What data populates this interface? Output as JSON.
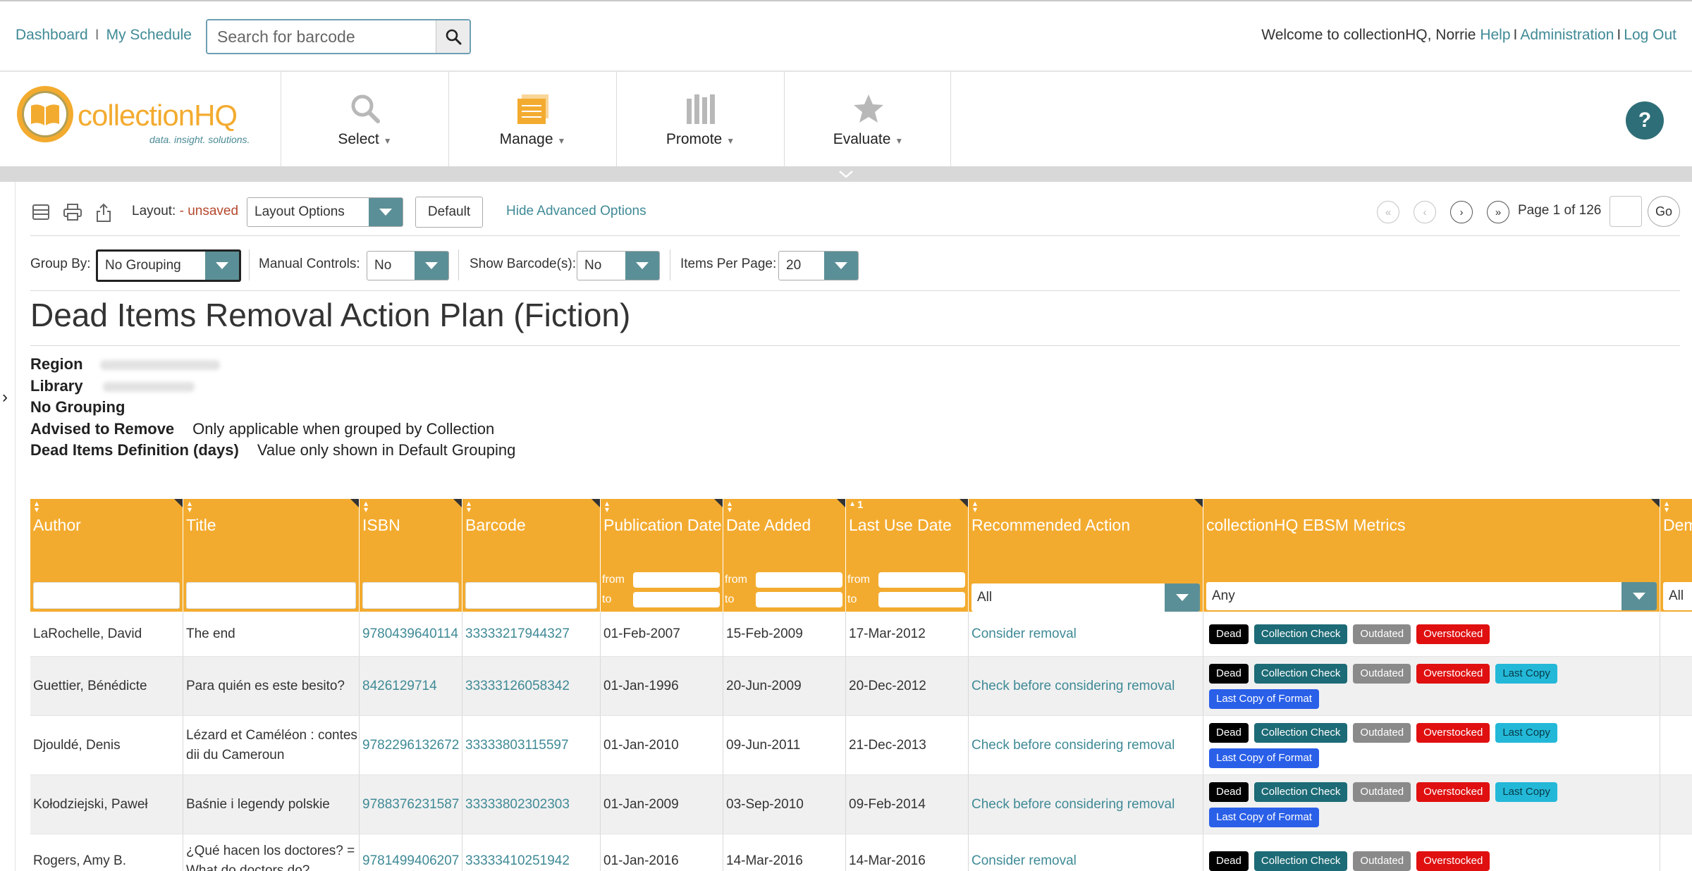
{
  "topbar": {
    "links": [
      "Dashboard",
      "My Schedule"
    ],
    "search_placeholder": "Search for barcode",
    "welcome": "Welcome to collectionHQ, Norrie",
    "user_links": [
      "Help",
      "Administration",
      "Log Out"
    ]
  },
  "logo": {
    "name": "collectionHQ",
    "tagline": "data. insight. solutions."
  },
  "nav": [
    {
      "label": "Select",
      "icon": "search-icon"
    },
    {
      "label": "Manage",
      "icon": "layers-icon"
    },
    {
      "label": "Promote",
      "icon": "books-icon"
    },
    {
      "label": "Evaluate",
      "icon": "star-icon"
    }
  ],
  "help_button": "?",
  "toolbar": {
    "layout_label": "Layout:",
    "layout_status": "- unsaved",
    "layout_options": "Layout Options",
    "default_label": "Default",
    "hide_advanced": "Hide Advanced Options",
    "page_info": "Page 1 of 126",
    "go_label": "Go"
  },
  "options": {
    "group_by_label": "Group By:",
    "group_by_value": "No Grouping",
    "manual_controls_label": "Manual Controls:",
    "manual_controls_value": "No",
    "show_barcodes_label": "Show Barcode(s):",
    "show_barcodes_value": "No",
    "items_per_page_label": "Items Per Page:",
    "items_per_page_value": "20"
  },
  "report": {
    "title": "Dead Items Removal Action Plan (Fiction)",
    "region_label": "Region",
    "library_label": "Library",
    "grouping_label": "No Grouping",
    "advised_label": "Advised to Remove",
    "advised_value": "Only applicable when grouped by Collection",
    "definition_label": "Dead Items Definition (days)",
    "definition_value": "Value only shown in Default Grouping"
  },
  "grid": {
    "columns": [
      "Author",
      "Title",
      "ISBN",
      "Barcode",
      "Publication Date",
      "Date Added",
      "Last Use Date",
      "Recommended Action",
      "collectionHQ EBSM Metrics",
      "Dem"
    ],
    "range_from": "from",
    "range_to": "to",
    "sort_index": "1",
    "action_filter": "All",
    "metrics_filter": "Any",
    "dem_filter": "All",
    "rows": [
      {
        "author": "LaRochelle, David",
        "title": "The end",
        "isbn": "9780439640114",
        "barcode": "33333217944327",
        "pub": "01-Feb-2007",
        "added": "15-Feb-2009",
        "last_use": "17-Mar-2012",
        "action": "Consider removal",
        "badges": [
          "Dead",
          "Collection Check",
          "Outdated",
          "Overstocked"
        ]
      },
      {
        "author": "Guettier, Bénédicte",
        "title": "Para quién es este besito?",
        "isbn": "8426129714",
        "barcode": "33333126058342",
        "pub": "01-Jan-1996",
        "added": "20-Jun-2009",
        "last_use": "20-Dec-2012",
        "action": "Check before considering removal",
        "badges": [
          "Dead",
          "Collection Check",
          "Outdated",
          "Overstocked",
          "Last Copy",
          "Last Copy of Format"
        ]
      },
      {
        "author": "Djouldé, Denis",
        "title": "Lézard et Caméléon : contes dii du Cameroun",
        "isbn": "9782296132672",
        "barcode": "33333803115597",
        "pub": "01-Jan-2010",
        "added": "09-Jun-2011",
        "last_use": "21-Dec-2013",
        "action": "Check before considering removal",
        "badges": [
          "Dead",
          "Collection Check",
          "Outdated",
          "Overstocked",
          "Last Copy",
          "Last Copy of Format"
        ]
      },
      {
        "author": "Kołodziejski, Paweł",
        "title": "Baśnie i legendy polskie",
        "isbn": "9788376231587",
        "barcode": "33333802302303",
        "pub": "01-Jan-2009",
        "added": "03-Sep-2010",
        "last_use": "09-Feb-2014",
        "action": "Check before considering removal",
        "badges": [
          "Dead",
          "Collection Check",
          "Outdated",
          "Overstocked",
          "Last Copy",
          "Last Copy of Format"
        ]
      },
      {
        "author": "Rogers, Amy B.",
        "title": "¿Qué hacen los doctores? = What do doctors do?",
        "isbn": "9781499406207",
        "barcode": "33333410251942",
        "pub": "01-Jan-2016",
        "added": "14-Mar-2016",
        "last_use": "14-Mar-2016",
        "action": "Consider removal",
        "badges": [
          "Dead",
          "Collection Check",
          "Outdated",
          "Overstocked"
        ]
      }
    ]
  },
  "colors": {
    "header_orange": "#f3ab2f",
    "link_teal": "#3f8a96",
    "select_arrow": "#5b8f97",
    "help_button": "#2e6e78"
  }
}
